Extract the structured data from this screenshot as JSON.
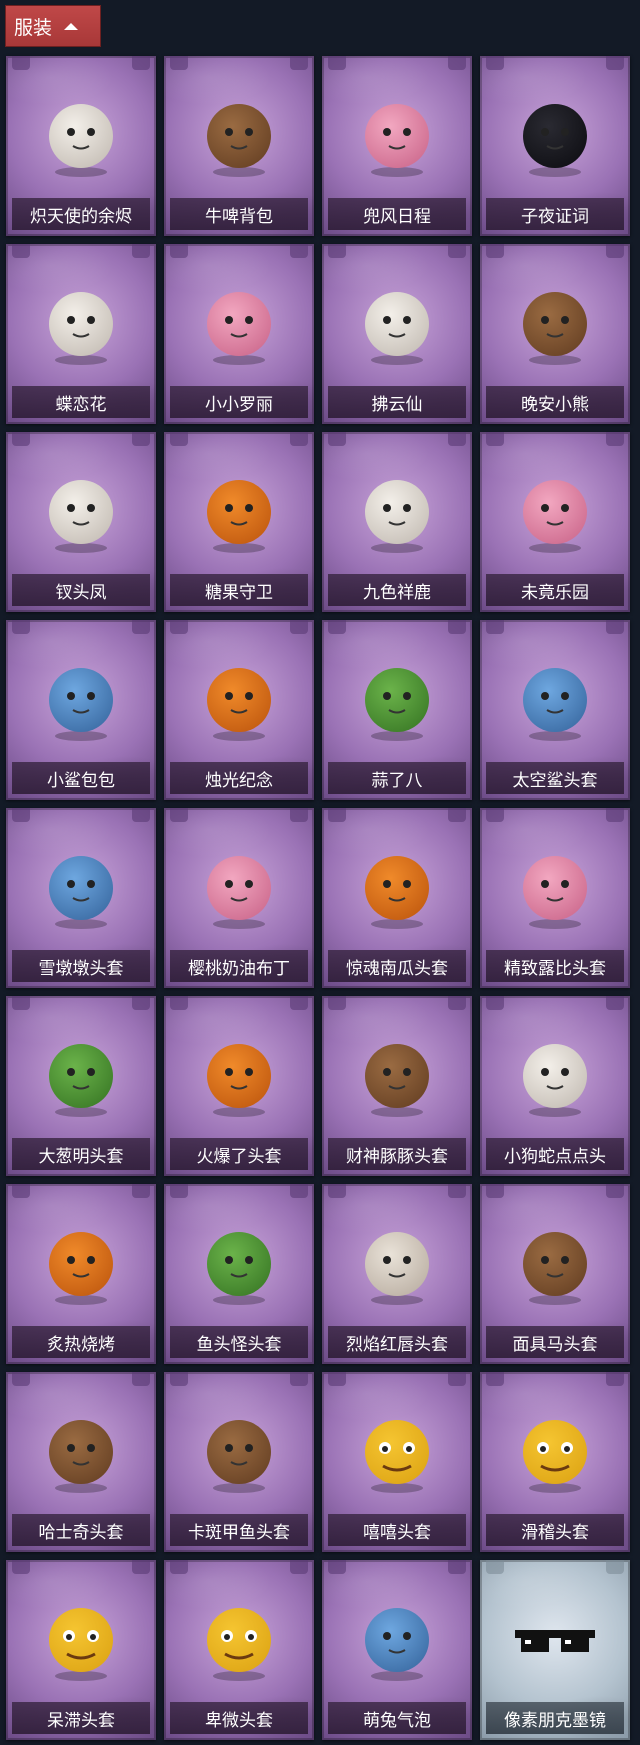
{
  "header": {
    "title": "服装"
  },
  "items": [
    {
      "label": "炽天使的余烬",
      "icon": "angel-doll-icon"
    },
    {
      "label": "牛啤背包",
      "icon": "cow-beer-barrel-icon"
    },
    {
      "label": "兜风日程",
      "icon": "pink-cap-doll-icon"
    },
    {
      "label": "子夜证词",
      "icon": "owl-top-hat-icon"
    },
    {
      "label": "蝶恋花",
      "icon": "bell-wreath-icon"
    },
    {
      "label": "小小罗丽",
      "icon": "chibi-girl-icon"
    },
    {
      "label": "拂云仙",
      "icon": "cloud-fairy-icon"
    },
    {
      "label": "晚安小熊",
      "icon": "teddy-bear-icon"
    },
    {
      "label": "钗头凤",
      "icon": "phoenix-crown-doll-icon"
    },
    {
      "label": "糖果守卫",
      "icon": "pumpkin-scarecrow-icon"
    },
    {
      "label": "九色祥鹿",
      "icon": "deer-icon"
    },
    {
      "label": "未竟乐园",
      "icon": "pastel-girl-icon"
    },
    {
      "label": "小鲨包包",
      "icon": "shark-bag-icon"
    },
    {
      "label": "烛光纪念",
      "icon": "candle-icon"
    },
    {
      "label": "蒜了八",
      "icon": "garlic-icon"
    },
    {
      "label": "太空鲨头套",
      "icon": "space-shark-head-icon"
    },
    {
      "label": "雪墩墩头套",
      "icon": "snowman-head-icon"
    },
    {
      "label": "樱桃奶油布丁",
      "icon": "pudding-icon"
    },
    {
      "label": "惊魂南瓜头套",
      "icon": "jack-o-lantern-icon"
    },
    {
      "label": "精致露比头套",
      "icon": "pink-glasses-head-icon"
    },
    {
      "label": "大葱明头套",
      "icon": "scallion-head-icon"
    },
    {
      "label": "火爆了头套",
      "icon": "fire-head-icon"
    },
    {
      "label": "财神豚豚头套",
      "icon": "capybara-head-icon"
    },
    {
      "label": "小狗蛇点点头",
      "icon": "snake-head-icon"
    },
    {
      "label": "炙热烧烤",
      "icon": "bbq-meat-icon"
    },
    {
      "label": "鱼头怪头套",
      "icon": "fish-head-icon"
    },
    {
      "label": "烈焰红唇头套",
      "icon": "yellow-mascot-head-icon"
    },
    {
      "label": "面具马头套",
      "icon": "horse-head-icon"
    },
    {
      "label": "哈士奇头套",
      "icon": "husky-head-icon"
    },
    {
      "label": "卡斑甲鱼头套",
      "icon": "turtle-head-icon"
    },
    {
      "label": "嘻嘻头套",
      "icon": "grin-emoji-icon"
    },
    {
      "label": "滑稽头套",
      "icon": "smirk-emoji-icon"
    },
    {
      "label": "呆滞头套",
      "icon": "dazed-emoji-icon"
    },
    {
      "label": "卑微头套",
      "icon": "humble-emoji-icon"
    },
    {
      "label": "萌兔气泡",
      "icon": "bubble-figure-icon"
    },
    {
      "label": "像素朋克墨镜",
      "icon": "pixel-sunglasses-icon",
      "rare": true
    }
  ]
}
